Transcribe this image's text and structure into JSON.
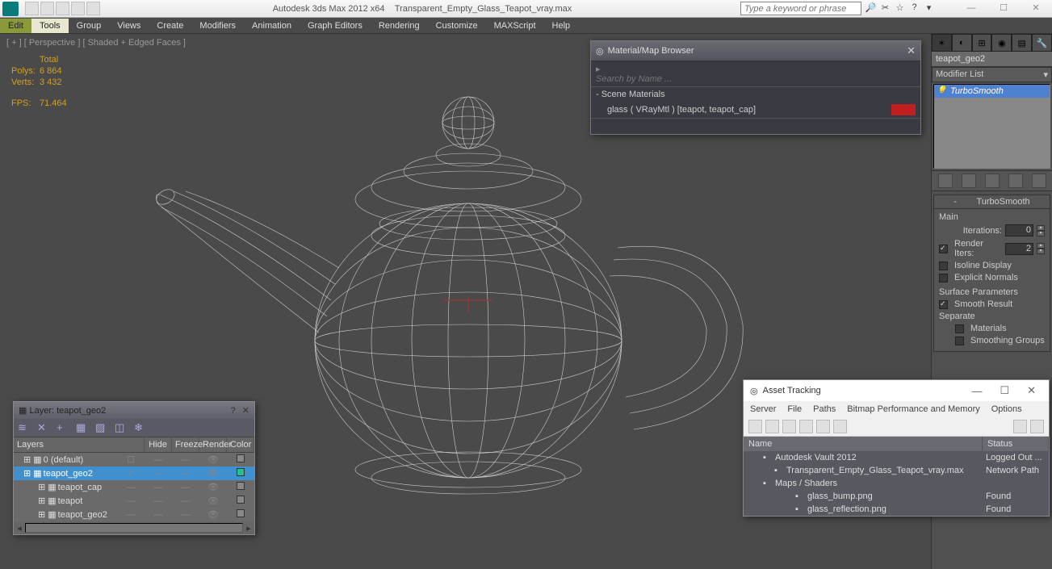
{
  "titlebar": {
    "app": "Autodesk 3ds Max  2012 x64",
    "file": "Transparent_Empty_Glass_Teapot_vray.max",
    "search_placeholder": "Type a keyword or phrase"
  },
  "menu": [
    "Edit",
    "Tools",
    "Group",
    "Views",
    "Create",
    "Modifiers",
    "Animation",
    "Graph Editors",
    "Rendering",
    "Customize",
    "MAXScript",
    "Help"
  ],
  "viewport": {
    "label": "[ + ] [ Perspective ] [ Shaded + Edged Faces ]",
    "stats": {
      "total_label": "Total",
      "polys_label": "Polys:",
      "polys": "6 864",
      "verts_label": "Verts:",
      "verts": "3 432",
      "fps_label": "FPS:",
      "fps": "71.464"
    }
  },
  "mat_browser": {
    "title": "Material/Map Browser",
    "search_placeholder": "Search by Name ...",
    "section": "- Scene Materials",
    "item": "glass ( VRayMtl ) [teapot, teapot_cap]"
  },
  "command": {
    "obj_name": "teapot_geo2",
    "mod_list_label": "Modifier List",
    "stack_item": "TurboSmooth",
    "rollout_title": "TurboSmooth",
    "main_label": "Main",
    "iterations_label": "Iterations:",
    "iterations": "0",
    "render_iters_label": "Render Iters:",
    "render_iters": "2",
    "isoline": "Isoline Display",
    "explicit": "Explicit Normals",
    "surf_params": "Surface Parameters",
    "smooth_result": "Smooth Result",
    "separate": "Separate",
    "materials": "Materials",
    "smoothing_groups": "Smoothing Groups"
  },
  "layer": {
    "title": "Layer: teapot_geo2",
    "cols": {
      "layers": "Layers",
      "hide": "Hide",
      "freeze": "Freeze",
      "render": "Render",
      "color": "Color"
    },
    "rows": [
      {
        "indent": 12,
        "name": "0 (default)",
        "sel": false,
        "hide": "☐",
        "color": "#888"
      },
      {
        "indent": 12,
        "name": "teapot_geo2",
        "sel": true,
        "hide": "✓",
        "color": "#20c090"
      },
      {
        "indent": 30,
        "name": "teapot_cap",
        "sel": false,
        "hide": "",
        "color": "#888"
      },
      {
        "indent": 30,
        "name": "teapot",
        "sel": false,
        "hide": "",
        "color": "#888"
      },
      {
        "indent": 30,
        "name": "teapot_geo2",
        "sel": false,
        "hide": "",
        "color": "#888"
      }
    ]
  },
  "asset": {
    "title": "Asset Tracking",
    "menu": [
      "Server",
      "File",
      "Paths",
      "Bitmap Performance and Memory",
      "Options"
    ],
    "cols": {
      "name": "Name",
      "status": "Status"
    },
    "rows": [
      {
        "indent": 18,
        "name": "Autodesk Vault 2012",
        "status": "Logged Out ..."
      },
      {
        "indent": 32,
        "name": "Transparent_Empty_Glass_Teapot_vray.max",
        "status": "Network Path"
      },
      {
        "indent": 18,
        "name": "Maps / Shaders",
        "status": ""
      },
      {
        "indent": 58,
        "name": "glass_bump.png",
        "status": "Found"
      },
      {
        "indent": 58,
        "name": "glass_reflection.png",
        "status": "Found"
      }
    ]
  }
}
